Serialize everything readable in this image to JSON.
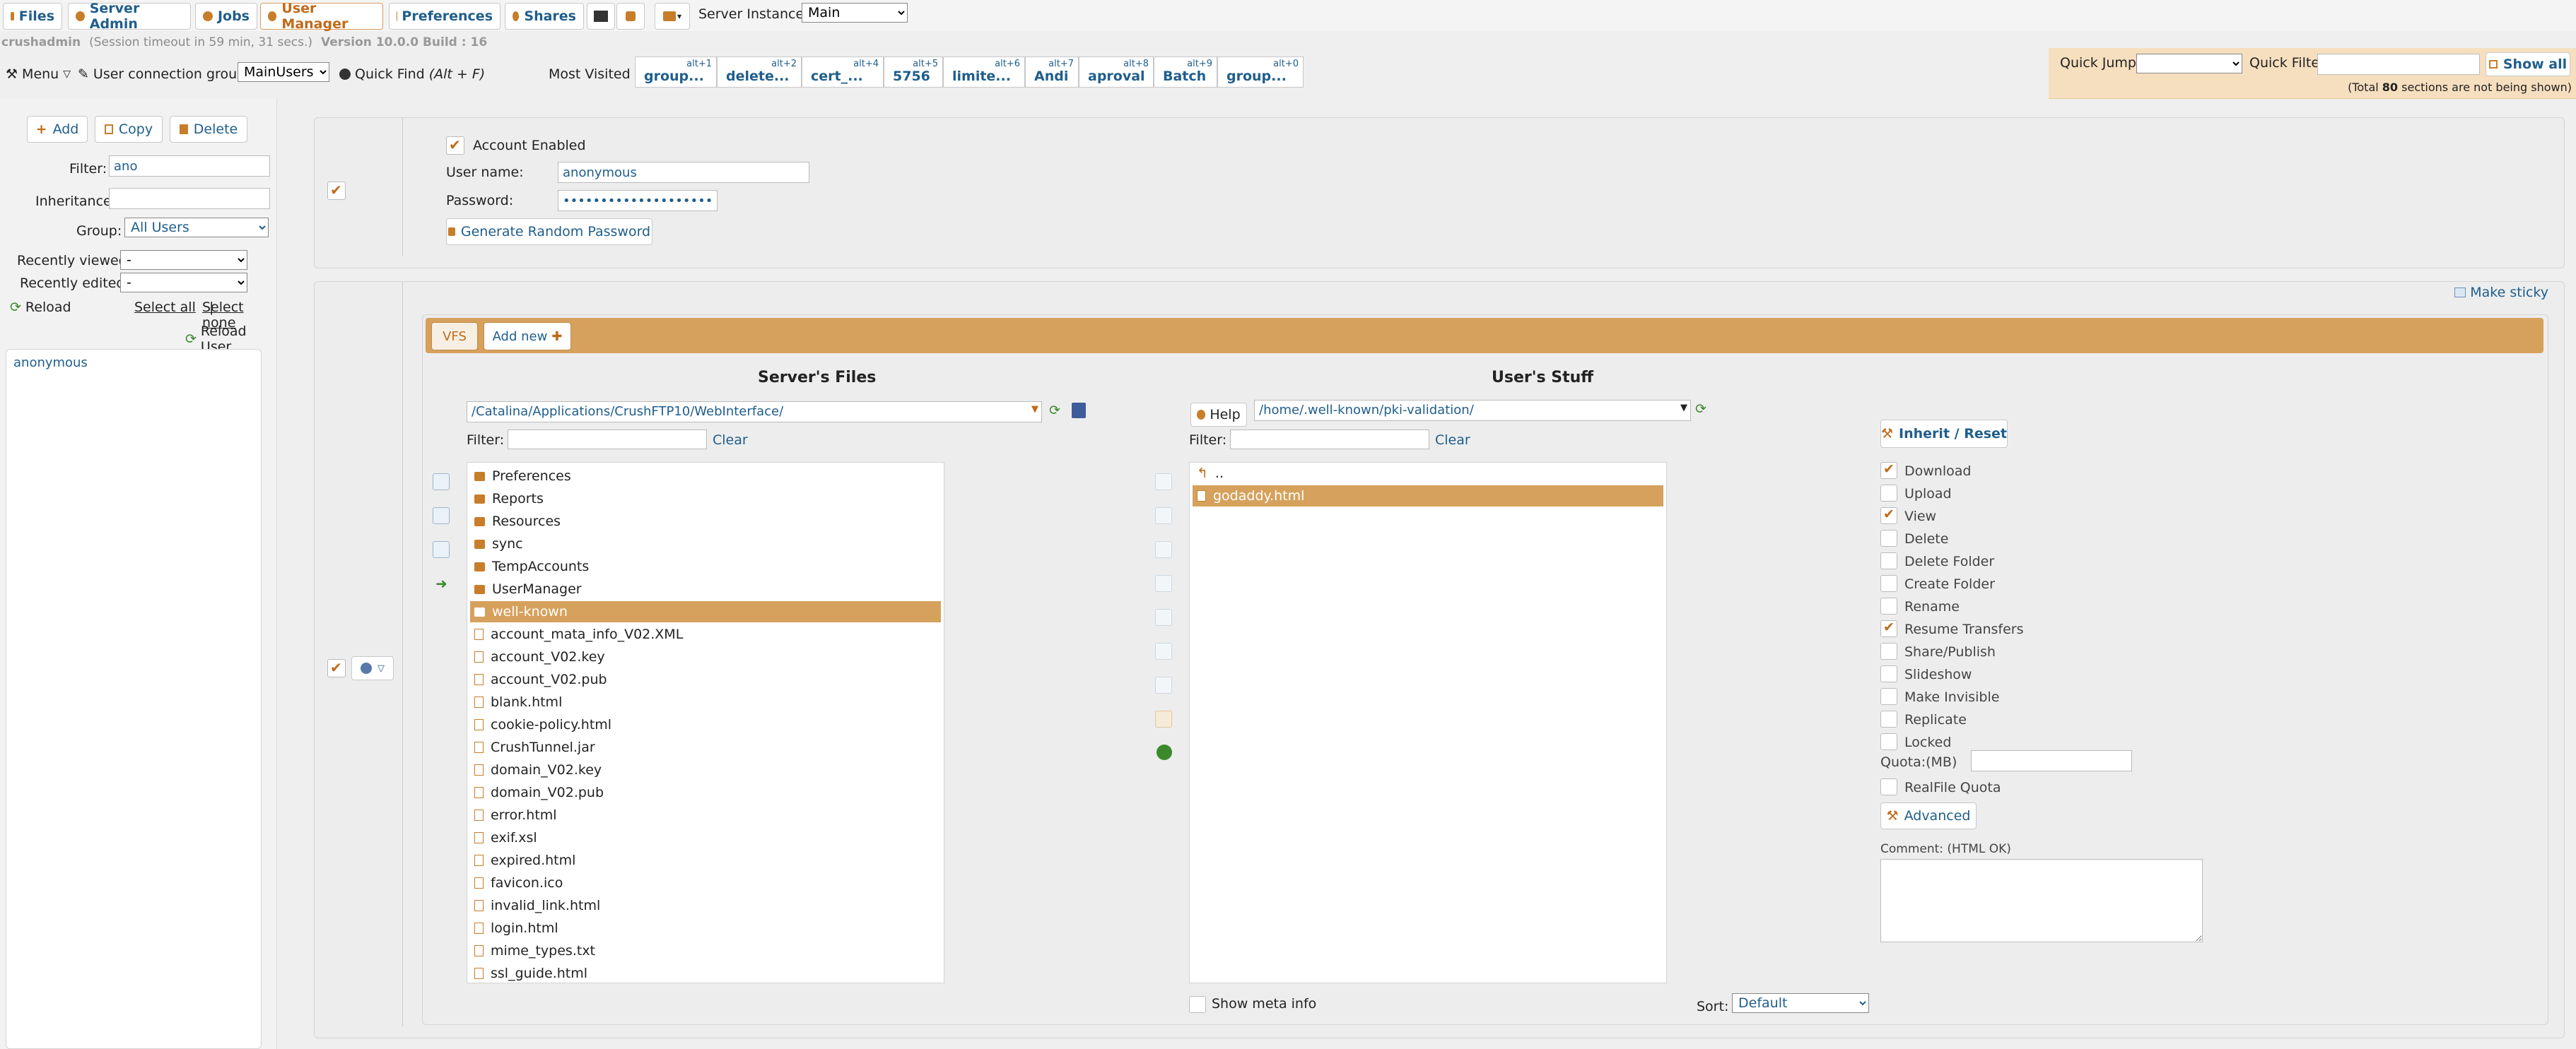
{
  "tabs": [
    {
      "id": "files",
      "label": "Files"
    },
    {
      "id": "server_admin",
      "label": "Server Admin"
    },
    {
      "id": "jobs",
      "label": "Jobs"
    },
    {
      "id": "user_manager",
      "label": "User Manager"
    },
    {
      "id": "preferences",
      "label": "Preferences"
    },
    {
      "id": "shares",
      "label": "Shares"
    }
  ],
  "server_instance": {
    "label": "Server Instance:",
    "value": "Main"
  },
  "session": {
    "user": "crushadmin",
    "timeout": "(Session timeout in 59 min, 31 secs.)",
    "version": "Version 10.0.0 Build : 16"
  },
  "toolbar": {
    "menu": "Menu",
    "connection_group_label": "User connection group:",
    "connection_group": "MainUsers",
    "quick_find": "Quick Find",
    "quick_find_key": "(Alt + F)",
    "most_visited": "Most Visited :"
  },
  "most_visited": [
    {
      "key": "alt+1",
      "label": "group..."
    },
    {
      "key": "alt+2",
      "label": "delete..."
    },
    {
      "key": "alt+4",
      "label": "cert_..."
    },
    {
      "key": "alt+5",
      "label": "5756"
    },
    {
      "key": "alt+6",
      "label": "limite..."
    },
    {
      "key": "alt+7",
      "label": "Andi"
    },
    {
      "key": "alt+8",
      "label": "aproval"
    },
    {
      "key": "alt+9",
      "label": "Batch"
    },
    {
      "key": "alt+0",
      "label": "group..."
    }
  ],
  "quick_jump": {
    "label": "Quick Jump:",
    "filter_label": "Quick Filter",
    "show_all": "Show all",
    "note_prefix": "(Total ",
    "note_count": "80",
    "note_suffix": " sections are not being shown)"
  },
  "left": {
    "add": "Add",
    "copy": "Copy",
    "delete": "Delete",
    "filter_label": "Filter:",
    "filter_value": "ano",
    "inheritance_label": "Inheritance:",
    "group_label": "Group:",
    "group_value": "All Users",
    "recently_viewed_label": "Recently viewed:",
    "recently_viewed": "-",
    "recently_edited_label": "Recently edited:",
    "recently_edited": "-",
    "reload": "Reload",
    "select_all": "Select all",
    "select_none": "Select none",
    "reload_user": "Reload User",
    "users": [
      "anonymous"
    ]
  },
  "account": {
    "enabled_label": "Account Enabled",
    "username_label": "User name:",
    "username": "anonymous",
    "password_label": "Password:",
    "password": "••••••••••••••••••••••",
    "generate": "Generate Random Password"
  },
  "vfs": {
    "make_sticky": "Make sticky",
    "tab_vfs": "VFS",
    "tab_add": "Add new",
    "server_files_title": "Server's Files",
    "user_stuff_title": "User's Stuff",
    "server_path": "/Catalina/Applications/CrushFTP10/WebInterface/",
    "user_path": "/home/.well-known/pki-validation/",
    "help": "Help",
    "filter_label": "Filter:",
    "clear": "Clear",
    "server_items": [
      {
        "name": "Preferences",
        "type": "folder"
      },
      {
        "name": "Reports",
        "type": "folder"
      },
      {
        "name": "Resources",
        "type": "folder"
      },
      {
        "name": "sync",
        "type": "folder"
      },
      {
        "name": "TempAccounts",
        "type": "folder"
      },
      {
        "name": "UserManager",
        "type": "folder"
      },
      {
        "name": "well-known",
        "type": "folder",
        "selected": true
      },
      {
        "name": "account_mata_info_V02.XML",
        "type": "file"
      },
      {
        "name": "account_V02.key",
        "type": "file"
      },
      {
        "name": "account_V02.pub",
        "type": "file"
      },
      {
        "name": "blank.html",
        "type": "file"
      },
      {
        "name": "cookie-policy.html",
        "type": "file"
      },
      {
        "name": "CrushTunnel.jar",
        "type": "file"
      },
      {
        "name": "domain_V02.key",
        "type": "file"
      },
      {
        "name": "domain_V02.pub",
        "type": "file"
      },
      {
        "name": "error.html",
        "type": "file"
      },
      {
        "name": "exif.xsl",
        "type": "file"
      },
      {
        "name": "expired.html",
        "type": "file"
      },
      {
        "name": "favicon.ico",
        "type": "file"
      },
      {
        "name": "invalid_link.html",
        "type": "file"
      },
      {
        "name": "login.html",
        "type": "file"
      },
      {
        "name": "mime_types.txt",
        "type": "file"
      },
      {
        "name": "ssl_guide.html",
        "type": "file"
      }
    ],
    "user_items": [
      {
        "name": "..",
        "type": "up"
      },
      {
        "name": "godaddy.html",
        "type": "file",
        "selected": true
      }
    ],
    "show_meta": "Show meta info",
    "sort_label": "Sort:",
    "sort_value": "Default"
  },
  "permissions": {
    "inherit": "Inherit / Reset",
    "items": [
      {
        "label": "Download",
        "checked": true
      },
      {
        "label": "Upload",
        "checked": false
      },
      {
        "label": "View",
        "checked": true
      },
      {
        "label": "Delete",
        "checked": false
      },
      {
        "label": "Delete Folder",
        "checked": false
      },
      {
        "label": "Create Folder",
        "checked": false
      },
      {
        "label": "Rename",
        "checked": false
      },
      {
        "label": "Resume Transfers",
        "checked": true
      },
      {
        "label": "Share/Publish",
        "checked": false
      },
      {
        "label": "Slideshow",
        "checked": false
      },
      {
        "label": "Make Invisible",
        "checked": false
      },
      {
        "label": "Replicate",
        "checked": false
      },
      {
        "label": "Locked",
        "checked": false
      }
    ],
    "quota_label": "Quota:(MB)",
    "realfile_quota": "RealFile Quota",
    "advanced": "Advanced",
    "comment_label": "Comment: (HTML OK)"
  }
}
